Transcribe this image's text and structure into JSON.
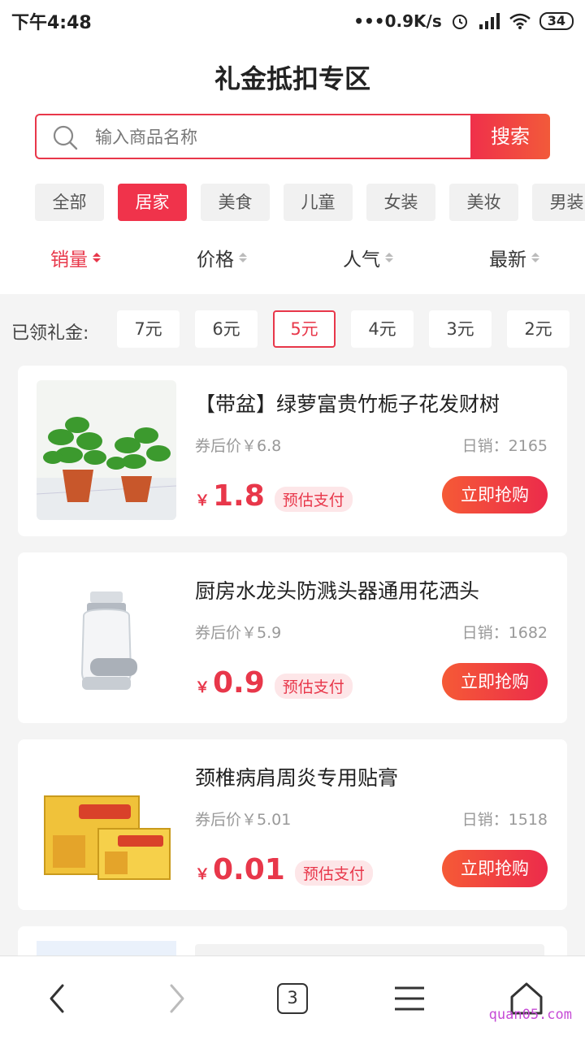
{
  "status": {
    "time": "下午4:48",
    "network": "•••0.9K/s",
    "battery": "34"
  },
  "header": {
    "title": "礼金抵扣专区",
    "search_placeholder": "输入商品名称",
    "search_button": "搜索"
  },
  "categories": [
    "全部",
    "居家",
    "美食",
    "儿童",
    "女装",
    "美妆",
    "男装"
  ],
  "active_category": "居家",
  "sort_options": [
    {
      "label": "销量",
      "active": true
    },
    {
      "label": "价格",
      "active": false
    },
    {
      "label": "人气",
      "active": false
    },
    {
      "label": "最新",
      "active": false
    }
  ],
  "coupon": {
    "label": "已领礼金:",
    "options": [
      "7元",
      "6元",
      "5元",
      "4元",
      "3元",
      "2元"
    ],
    "active": "5元"
  },
  "products": [
    {
      "title": "【带盆】绿萝富贵竹栀子花发财树",
      "after_coupon": "券后价￥6.8",
      "daily_sales": "日销：2165",
      "yen": "￥",
      "price": "1.8",
      "tag": "预估支付",
      "button": "立即抢购"
    },
    {
      "title": "厨房水龙头防溅头器通用花洒头",
      "after_coupon": "券后价￥5.9",
      "daily_sales": "日销：1682",
      "yen": "￥",
      "price": "0.9",
      "tag": "预估支付",
      "button": "立即抢购"
    },
    {
      "title": "颈椎病肩周炎专用贴膏",
      "after_coupon": "券后价￥5.01",
      "daily_sales": "日销：1518",
      "yen": "￥",
      "price": "0.01",
      "tag": "预估支付",
      "button": "立即抢购"
    }
  ],
  "nav": {
    "tab_count": "3",
    "watermark": "quan05.com"
  },
  "colors": {
    "accent": "#e8374a",
    "tag_bg": "#fde6e8",
    "page_bg": "#f4f4f4"
  }
}
